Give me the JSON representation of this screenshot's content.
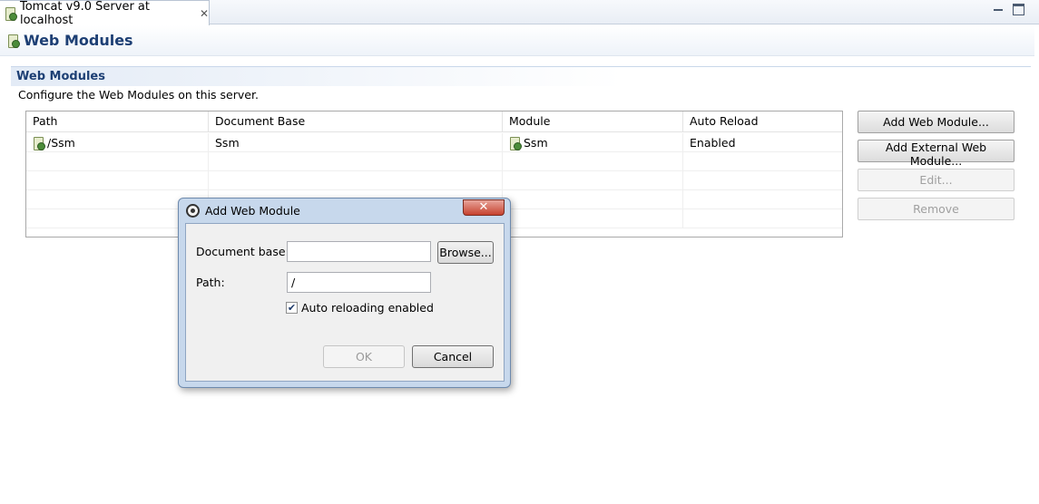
{
  "editor_tab": {
    "title": "Tomcat v9.0 Server at localhost",
    "close_glyph": "✕"
  },
  "page": {
    "title": "Web Modules"
  },
  "section": {
    "title": "Web Modules",
    "description": "Configure the Web Modules on this server."
  },
  "table": {
    "columns": [
      "Path",
      "Document Base",
      "Module",
      "Auto Reload"
    ],
    "rows": [
      {
        "path": "/Ssm",
        "document_base": "Ssm",
        "module": "Ssm",
        "auto_reload": "Enabled"
      }
    ]
  },
  "side_buttons": {
    "add_web_module": "Add Web Module...",
    "add_external_web_module": "Add External Web Module...",
    "edit": "Edit...",
    "remove": "Remove"
  },
  "dialog": {
    "title": "Add Web Module",
    "close_glyph": "✕",
    "document_base_label": "Document base:",
    "document_base_value": "",
    "browse_label": "Browse...",
    "path_label": "Path:",
    "path_value": "/",
    "auto_reload_label": "Auto reloading enabled",
    "auto_reload_check": "✔",
    "ok_label": "OK",
    "cancel_label": "Cancel"
  },
  "icons": {
    "tab": "server-icon",
    "header": "server-icon",
    "row_path": "web-module-icon",
    "row_module": "web-module-icon",
    "dialog": "eclipse-icon"
  }
}
